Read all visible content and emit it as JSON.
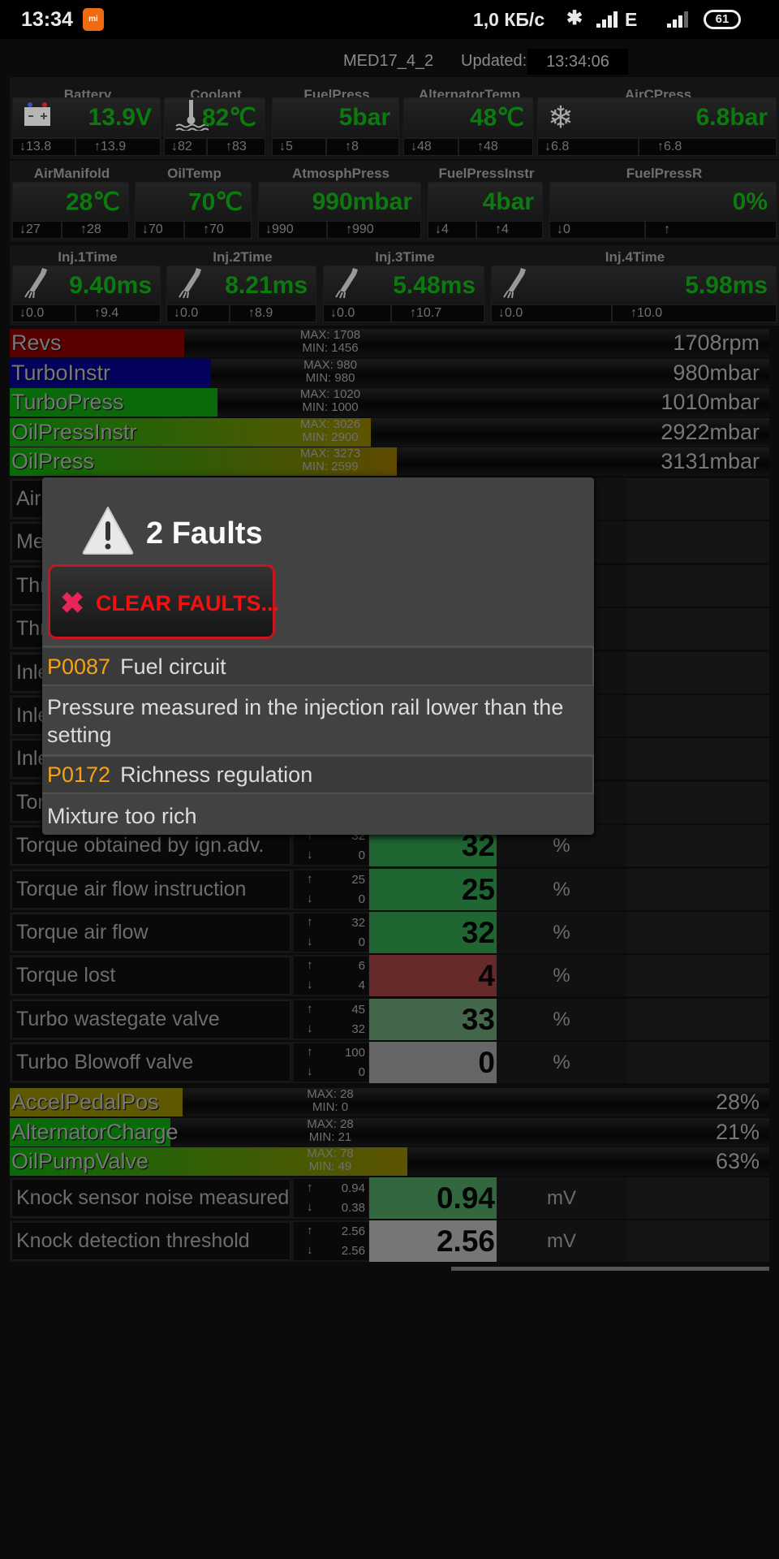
{
  "status_bar": {
    "time": "13:34",
    "net_speed": "1,0 КБ/с",
    "network": "E",
    "battery": "61",
    "icons": [
      "mi-app-icon",
      "bluetooth-icon",
      "signal-icon",
      "signal-icon",
      "battery-icon"
    ]
  },
  "header": {
    "ecu": "MED17_4_2",
    "updated_label": "Updated:",
    "updated_time": "13:34:06"
  },
  "gauge_groups": [
    [
      {
        "label": "Battery",
        "value": "13.9V",
        "min": "13.8",
        "max": "13.9",
        "icon": "battery-icon"
      },
      {
        "label": "Coolant",
        "value": "82℃",
        "min": "82",
        "max": "83",
        "icon": "thermometer-icon"
      },
      {
        "label": "FuelPress",
        "value": "5bar",
        "min": "5",
        "max": "8"
      },
      {
        "label": "AlternatorTemp",
        "value": "48℃",
        "min": "48",
        "max": "48"
      },
      {
        "label": "AirCPress",
        "value": "6.8bar",
        "min": "6.8",
        "max": "6.8",
        "icon": "snowflake-icon"
      }
    ],
    [
      {
        "label": "AirManifold",
        "value": "28℃",
        "min": "27",
        "max": "28"
      },
      {
        "label": "OilTemp",
        "value": "70℃",
        "min": "70",
        "max": "70"
      },
      {
        "label": "AtmosphPress",
        "value": "990mbar",
        "min": "990",
        "max": "990"
      },
      {
        "label": "FuelPressInstr",
        "value": "4bar",
        "min": "4",
        "max": "4"
      },
      {
        "label": "FuelPressR",
        "value": "0%",
        "min": "0",
        "max": ""
      }
    ],
    [
      {
        "label": "Inj.1Time",
        "value": "9.40ms",
        "min": "0.0",
        "max": "9.4",
        "icon": "injector-icon"
      },
      {
        "label": "Inj.2Time",
        "value": "8.21ms",
        "min": "0.0",
        "max": "8.9",
        "icon": "injector-icon"
      },
      {
        "label": "Inj.3Time",
        "value": "5.48ms",
        "min": "0.0",
        "max": "10.7",
        "icon": "injector-icon"
      },
      {
        "label": "Inj.4Time",
        "value": "5.98ms",
        "min": "0.0",
        "max": "10.0",
        "icon": "injector-icon"
      }
    ]
  ],
  "bars_top": [
    {
      "name": "Revs",
      "max": "MAX: 1708",
      "min": "MIN: 1456",
      "value": "1708rpm",
      "level": 0.23,
      "color": "#5a0000"
    },
    {
      "name": "TurboInstr",
      "max": "MAX: 980",
      "min": "MIN: 980",
      "value": "980mbar",
      "level": 0.265,
      "color": "#03035e"
    },
    {
      "name": "TurboPress",
      "max": "MAX: 1020",
      "min": "MIN: 1000",
      "value": "1010mbar",
      "level": 0.273,
      "color": "#0a6a0a"
    },
    {
      "name": "OilPressInstr",
      "max": "MAX: 3026",
      "min": "MIN: 2900",
      "value": "2922mbar",
      "level": 0.475,
      "color": "#0a6a0a",
      "color2": "#5e5300"
    },
    {
      "name": "OilPress",
      "max": "MAX: 3273",
      "min": "MIN: 2599",
      "value": "3131mbar",
      "level": 0.51,
      "color": "#0a6a0a",
      "color2": "#5e4a00"
    }
  ],
  "rows": [
    {
      "name": "Air"
    },
    {
      "name": "Me"
    },
    {
      "name": "Thr"
    },
    {
      "name": "Thr"
    },
    {
      "name": "Inle"
    },
    {
      "name": "Inle"
    },
    {
      "name": "Inle"
    },
    {
      "name": "Tor"
    },
    {
      "name": "Torque obtained by ign.adv.",
      "max": "32",
      "min": "0",
      "value": "32",
      "unit": "%",
      "color": "#1f6633"
    },
    {
      "name": "Torque air flow instruction",
      "max": "25",
      "min": "0",
      "value": "25",
      "unit": "%",
      "color": "#1f6633"
    },
    {
      "name": "Torque air flow",
      "max": "32",
      "min": "0",
      "value": "32",
      "unit": "%",
      "color": "#1f6633"
    },
    {
      "name": "Torque lost",
      "max": "6",
      "min": "4",
      "value": "4",
      "unit": "%",
      "color": "#672a2a"
    },
    {
      "name": "Turbo wastegate valve",
      "max": "45",
      "min": "32",
      "value": "33",
      "unit": "%",
      "color": "#44674c"
    },
    {
      "name": "Turbo Blowoff valve",
      "max": "100",
      "min": "0",
      "value": "0",
      "unit": "%",
      "color": "#666666"
    }
  ],
  "bars_bottom": [
    {
      "name": "AccelPedalPos",
      "max": "MAX: 28",
      "min": "MIN: 0",
      "value": "28%",
      "level": 0.228,
      "color": "#5e5800"
    },
    {
      "name": "AlternatorCharge",
      "max": "MAX: 28",
      "min": "MIN: 21",
      "value": "21%",
      "level": 0.212,
      "color": "#0a6a0a"
    },
    {
      "name": "OilPumpValve",
      "max": "MAX: 78",
      "min": "MIN: 49",
      "value": "63%",
      "level": 0.523,
      "color": "#0a6a0a",
      "color2": "#5e5300"
    }
  ],
  "rows_bottom": [
    {
      "name": "Knock sensor noise measured",
      "max": "0.94",
      "min": "0.38",
      "value": "0.94",
      "unit": "mV",
      "color": "#33673f"
    },
    {
      "name": "Knock detection threshold",
      "max": "2.56",
      "min": "2.56",
      "value": "2.56",
      "unit": "mV",
      "color": "#767676"
    }
  ],
  "dialog": {
    "title": "2 Faults",
    "clear_label": "CLEAR FAULTS...",
    "faults": [
      {
        "code": "P0087",
        "name": "Fuel circuit",
        "description": "Pressure measured in the injection rail lower than the setting"
      },
      {
        "code": "P0172",
        "name": "Richness regulation",
        "description": "Mixture too rich"
      }
    ]
  }
}
